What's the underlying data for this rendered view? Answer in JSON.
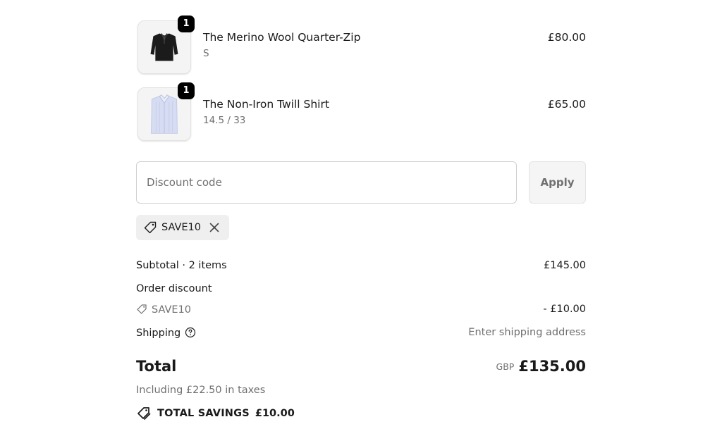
{
  "line_items": [
    {
      "quantity": "1",
      "name": "The Merino Wool Quarter-Zip",
      "variant": "S",
      "price": "£80.00",
      "image_icon": "black-quarter-zip-sweater"
    },
    {
      "quantity": "1",
      "name": "The Non-Iron Twill Shirt",
      "variant": "14.5 / 33",
      "price": "£65.00",
      "image_icon": "light-blue-dress-shirt"
    }
  ],
  "discount": {
    "placeholder": "Discount code",
    "apply_label": "Apply",
    "applied_code": "SAVE10",
    "icon": "tag-icon",
    "remove_icon": "close-icon"
  },
  "totals": {
    "subtotal_label": "Subtotal · 2 items",
    "subtotal_value": "£145.00",
    "order_discount_label": "Order discount",
    "order_discount_code": "SAVE10",
    "order_discount_value": "- £10.00",
    "shipping_label": "Shipping",
    "shipping_value": "Enter shipping address",
    "shipping_help_icon": "help-circle-icon",
    "total_label": "Total",
    "currency": "GBP",
    "total_value": "£135.00",
    "tax_note": "Including £22.50 in taxes",
    "savings_label": "TOTAL SAVINGS",
    "savings_value": "£10.00",
    "savings_icon": "double-tag-icon"
  },
  "colors": {
    "text": "#1a1a1a",
    "muted": "#707070",
    "badge": "#000000",
    "chip_bg": "#efefef",
    "button_bg": "#f5f5f5"
  }
}
